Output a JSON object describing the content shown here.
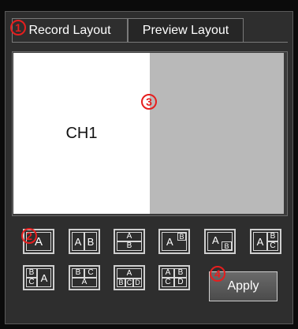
{
  "tabs": [
    {
      "label": "Record Layout",
      "active": true
    },
    {
      "label": "Preview Layout",
      "active": false
    }
  ],
  "preview": {
    "channel_label": "CH1"
  },
  "layouts": {
    "full": "A",
    "split_a": "A",
    "split_b": "B",
    "stack_a": "A",
    "stack_b": "B",
    "pip_a": "A",
    "pip_b": "B",
    "pip2_a": "A",
    "pip2_b": "B",
    "three_right_a": "A",
    "three_right_b": "B",
    "three_right_c": "C",
    "three_left_b": "B",
    "three_left_c": "C",
    "three_left_a": "A",
    "three_top_b": "B",
    "three_top_c": "C",
    "three_top_a": "A",
    "four_bottom_a": "A",
    "four_bottom_b": "B",
    "four_bottom_c": "C",
    "four_bottom_d": "D",
    "quad_a": "A",
    "quad_b": "B",
    "quad_c": "C",
    "quad_d": "D"
  },
  "apply_button": {
    "label": "Apply"
  },
  "markers": {
    "m1": "1",
    "m2": "2",
    "m3": "3",
    "m4": "4"
  },
  "colors": {
    "accent": "#e61e1e",
    "panel": "#2e2e2e",
    "preview_primary": "#ffffff",
    "preview_secondary": "#b9b9b9"
  }
}
